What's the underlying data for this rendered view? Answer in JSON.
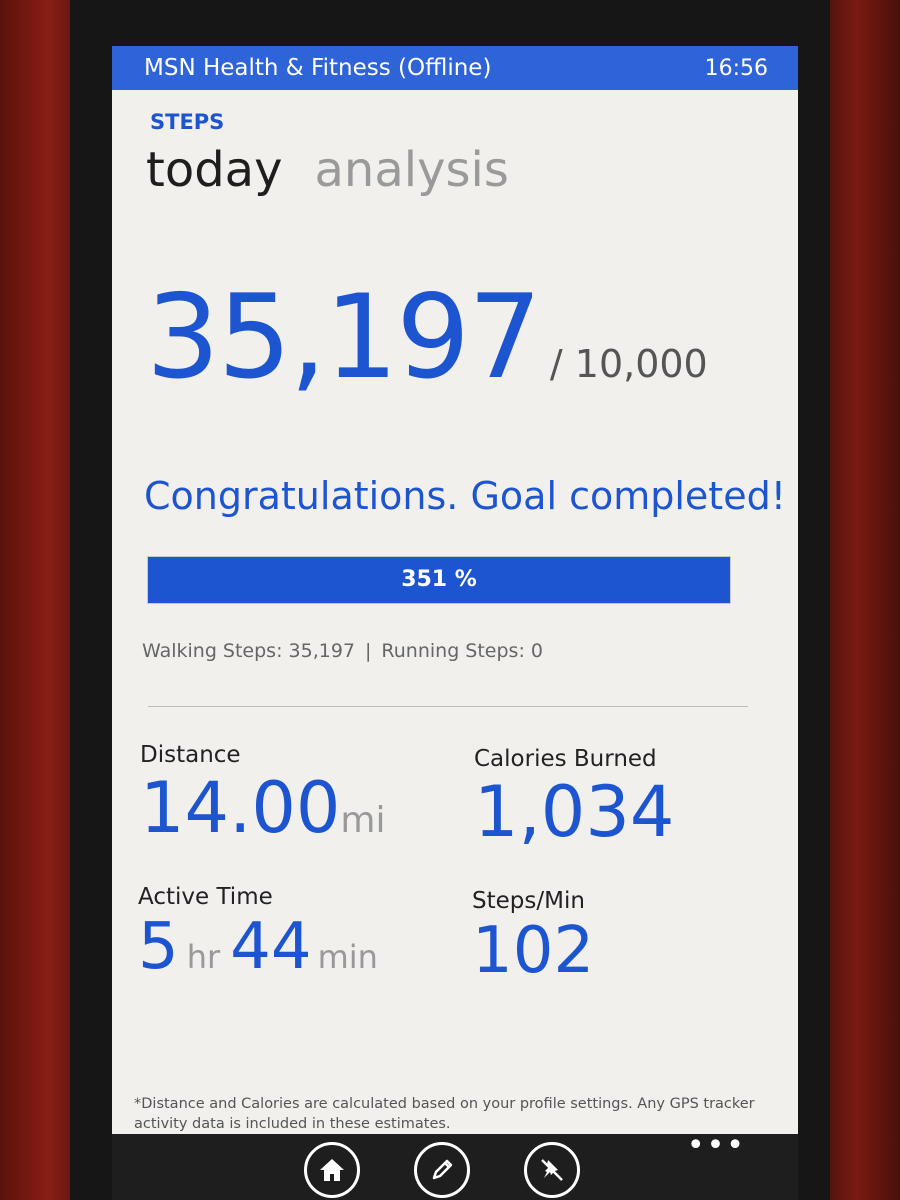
{
  "titlebar": {
    "app_title": "MSN Health & Fitness (Offline)",
    "time": "16:56"
  },
  "section": "STEPS",
  "pivot": {
    "active": "today",
    "inactive": "analysis"
  },
  "steps": {
    "count": "35,197",
    "goal": "/ 10,000",
    "progress_percent": 351,
    "progress_label": "351 %"
  },
  "message": "Congratulations. Goal completed!",
  "breakdown": {
    "walking": "Walking Steps: 35,197",
    "separator": "|",
    "running": "Running Steps: 0"
  },
  "stats": {
    "distance": {
      "label": "Distance",
      "value": "14.00",
      "unit": "mi"
    },
    "calories": {
      "label": "Calories Burned",
      "value": "1,034"
    },
    "active_time": {
      "label": "Active Time",
      "hours": "5",
      "hours_unit": "hr",
      "minutes": "44",
      "minutes_unit": "min"
    },
    "steps_per_min": {
      "label": "Steps/Min",
      "value": "102"
    }
  },
  "footnote": "*Distance and Calories are calculated based on your profile settings. Any GPS tracker activity data is included in these estimates.",
  "appbar": {
    "buttons": [
      {
        "icon": "home-icon"
      },
      {
        "icon": "edit-icon"
      },
      {
        "icon": "unpin-icon"
      }
    ],
    "more": "•••"
  },
  "colors": {
    "accent": "#1d55d1",
    "titlebar": "#2f63d8",
    "background": "#f1f0ec",
    "appbar": "#1e1e1e"
  }
}
